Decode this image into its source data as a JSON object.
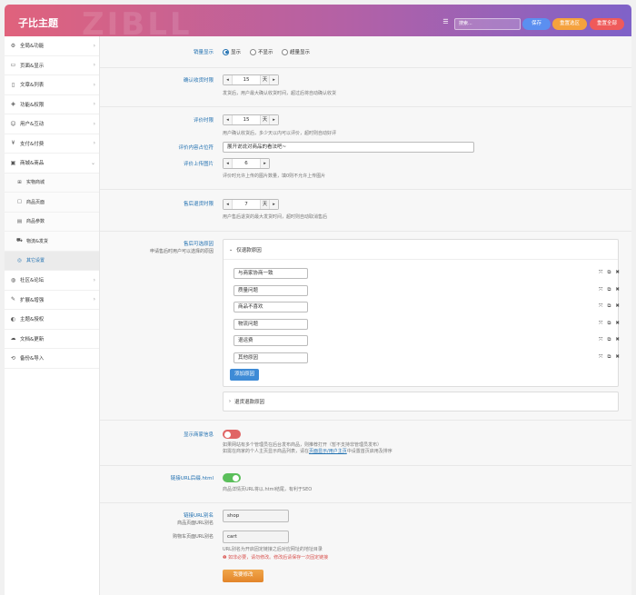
{
  "header": {
    "watermark": "ZIBLL",
    "title": "子比主题",
    "search_placeholder": "搜索...",
    "save": "保存",
    "reset_section": "重置选区",
    "reset_all": "重置全部",
    "colors": {
      "save": "#5b8ff0",
      "reset_section": "#f5a23d",
      "reset_all": "#ef5a5a"
    }
  },
  "sidebar": {
    "items": [
      {
        "icon": "⚙",
        "label": "全局&功能",
        "arrow": "›"
      },
      {
        "icon": "▭",
        "label": "页面&显示",
        "arrow": "›"
      },
      {
        "icon": "▯",
        "label": "文章&列表",
        "arrow": "›"
      },
      {
        "icon": "◈",
        "label": "功能&权限",
        "arrow": "›"
      },
      {
        "icon": "☺",
        "label": "用户&互动",
        "arrow": "›"
      },
      {
        "icon": "¥",
        "label": "支付&付费",
        "arrow": "›"
      },
      {
        "icon": "▣",
        "label": "商城&商品",
        "arrow": "⌄"
      }
    ],
    "sub_items": [
      {
        "icon": "⊞",
        "label": "实物商城"
      },
      {
        "icon": "▢",
        "label": "商品页面"
      },
      {
        "icon": "▤",
        "label": "商品参数"
      },
      {
        "icon": "⛟",
        "label": "物流&发货"
      },
      {
        "icon": "◎",
        "label": "其它设置"
      }
    ],
    "items2": [
      {
        "icon": "◍",
        "label": "社区&论坛",
        "arrow": "›"
      },
      {
        "icon": "✎",
        "label": "扩展&增强",
        "arrow": "›"
      },
      {
        "icon": "◐",
        "label": "主题&授权",
        "arrow": ""
      },
      {
        "icon": "☁",
        "label": "文档&更新",
        "arrow": ""
      },
      {
        "icon": "⟲",
        "label": "备份&导入",
        "arrow": ""
      }
    ]
  },
  "settings": {
    "sales_display": {
      "label": "销量显示",
      "options": [
        "显示",
        "不显示",
        "超量显示"
      ],
      "selected": 0
    },
    "confirm_receipt": {
      "label": "确认收货时限",
      "value": "15",
      "unit": "天",
      "minus": "◂",
      "plus": "▸",
      "desc": "发货后，用户最大确认收货时间，超过后将自动确认收货"
    },
    "review_limit": {
      "label": "评价时限",
      "value": "15",
      "unit": "天",
      "desc": "用户确认收货后，多少天以内可以评价，超时则自动好评"
    },
    "review_placeholder": {
      "label": "评价内容占位符",
      "value": "展开说说对商品的看法吧~"
    },
    "review_images": {
      "label": "评价上传图片",
      "value": "6",
      "desc": "评价时允许上传的图片数量，填0则不允许上传图片"
    },
    "after_sale_limit": {
      "label": "售后退货时限",
      "value": "7",
      "unit": "天",
      "desc": "用户售后退货的最大发货时间，超时则自动取消售后"
    },
    "after_sale_reasons": {
      "label": "售后可选原因",
      "sublabel": "申请售后时用户可以选择的原因",
      "refund_title": "仅退款原因",
      "refund_reasons": [
        "与商家协商一致",
        "质量问题",
        "商品不喜欢",
        "物流问题",
        "退运费",
        "其他原因"
      ],
      "add_btn": "添加原因",
      "return_title": "退货退款原因",
      "action_icons": [
        "⤧",
        "⧉",
        "✖"
      ]
    },
    "merchant_info": {
      "label": "显示商家信息",
      "on": false,
      "desc1": "如果网站有多个管理员在后台发布商品，则推荐打开（暂不支持非管理员发布）",
      "desc2_a": "如需在商家的个人主页显示商品列表，请在",
      "desc2_link": "页面显示/用户主页",
      "desc2_b": "中设置首页启用及排序"
    },
    "html_suffix": {
      "label": "链接URL后缀.html",
      "on": true,
      "desc": "商品详情页URL将以.html结尾，有利于SEO"
    },
    "url_alias": {
      "label": "链接URL别名",
      "shop_label": "商品页面URL别名",
      "shop_value": "shop",
      "cart_label": "购物车页面URL别名",
      "cart_value": "cart",
      "desc": "URL别名为开启固定链接之后对应网址的地址目录",
      "warn": "❶ 如非必要，请勿修改。修改后请保存一次固定链接",
      "button": "我要修改"
    }
  }
}
